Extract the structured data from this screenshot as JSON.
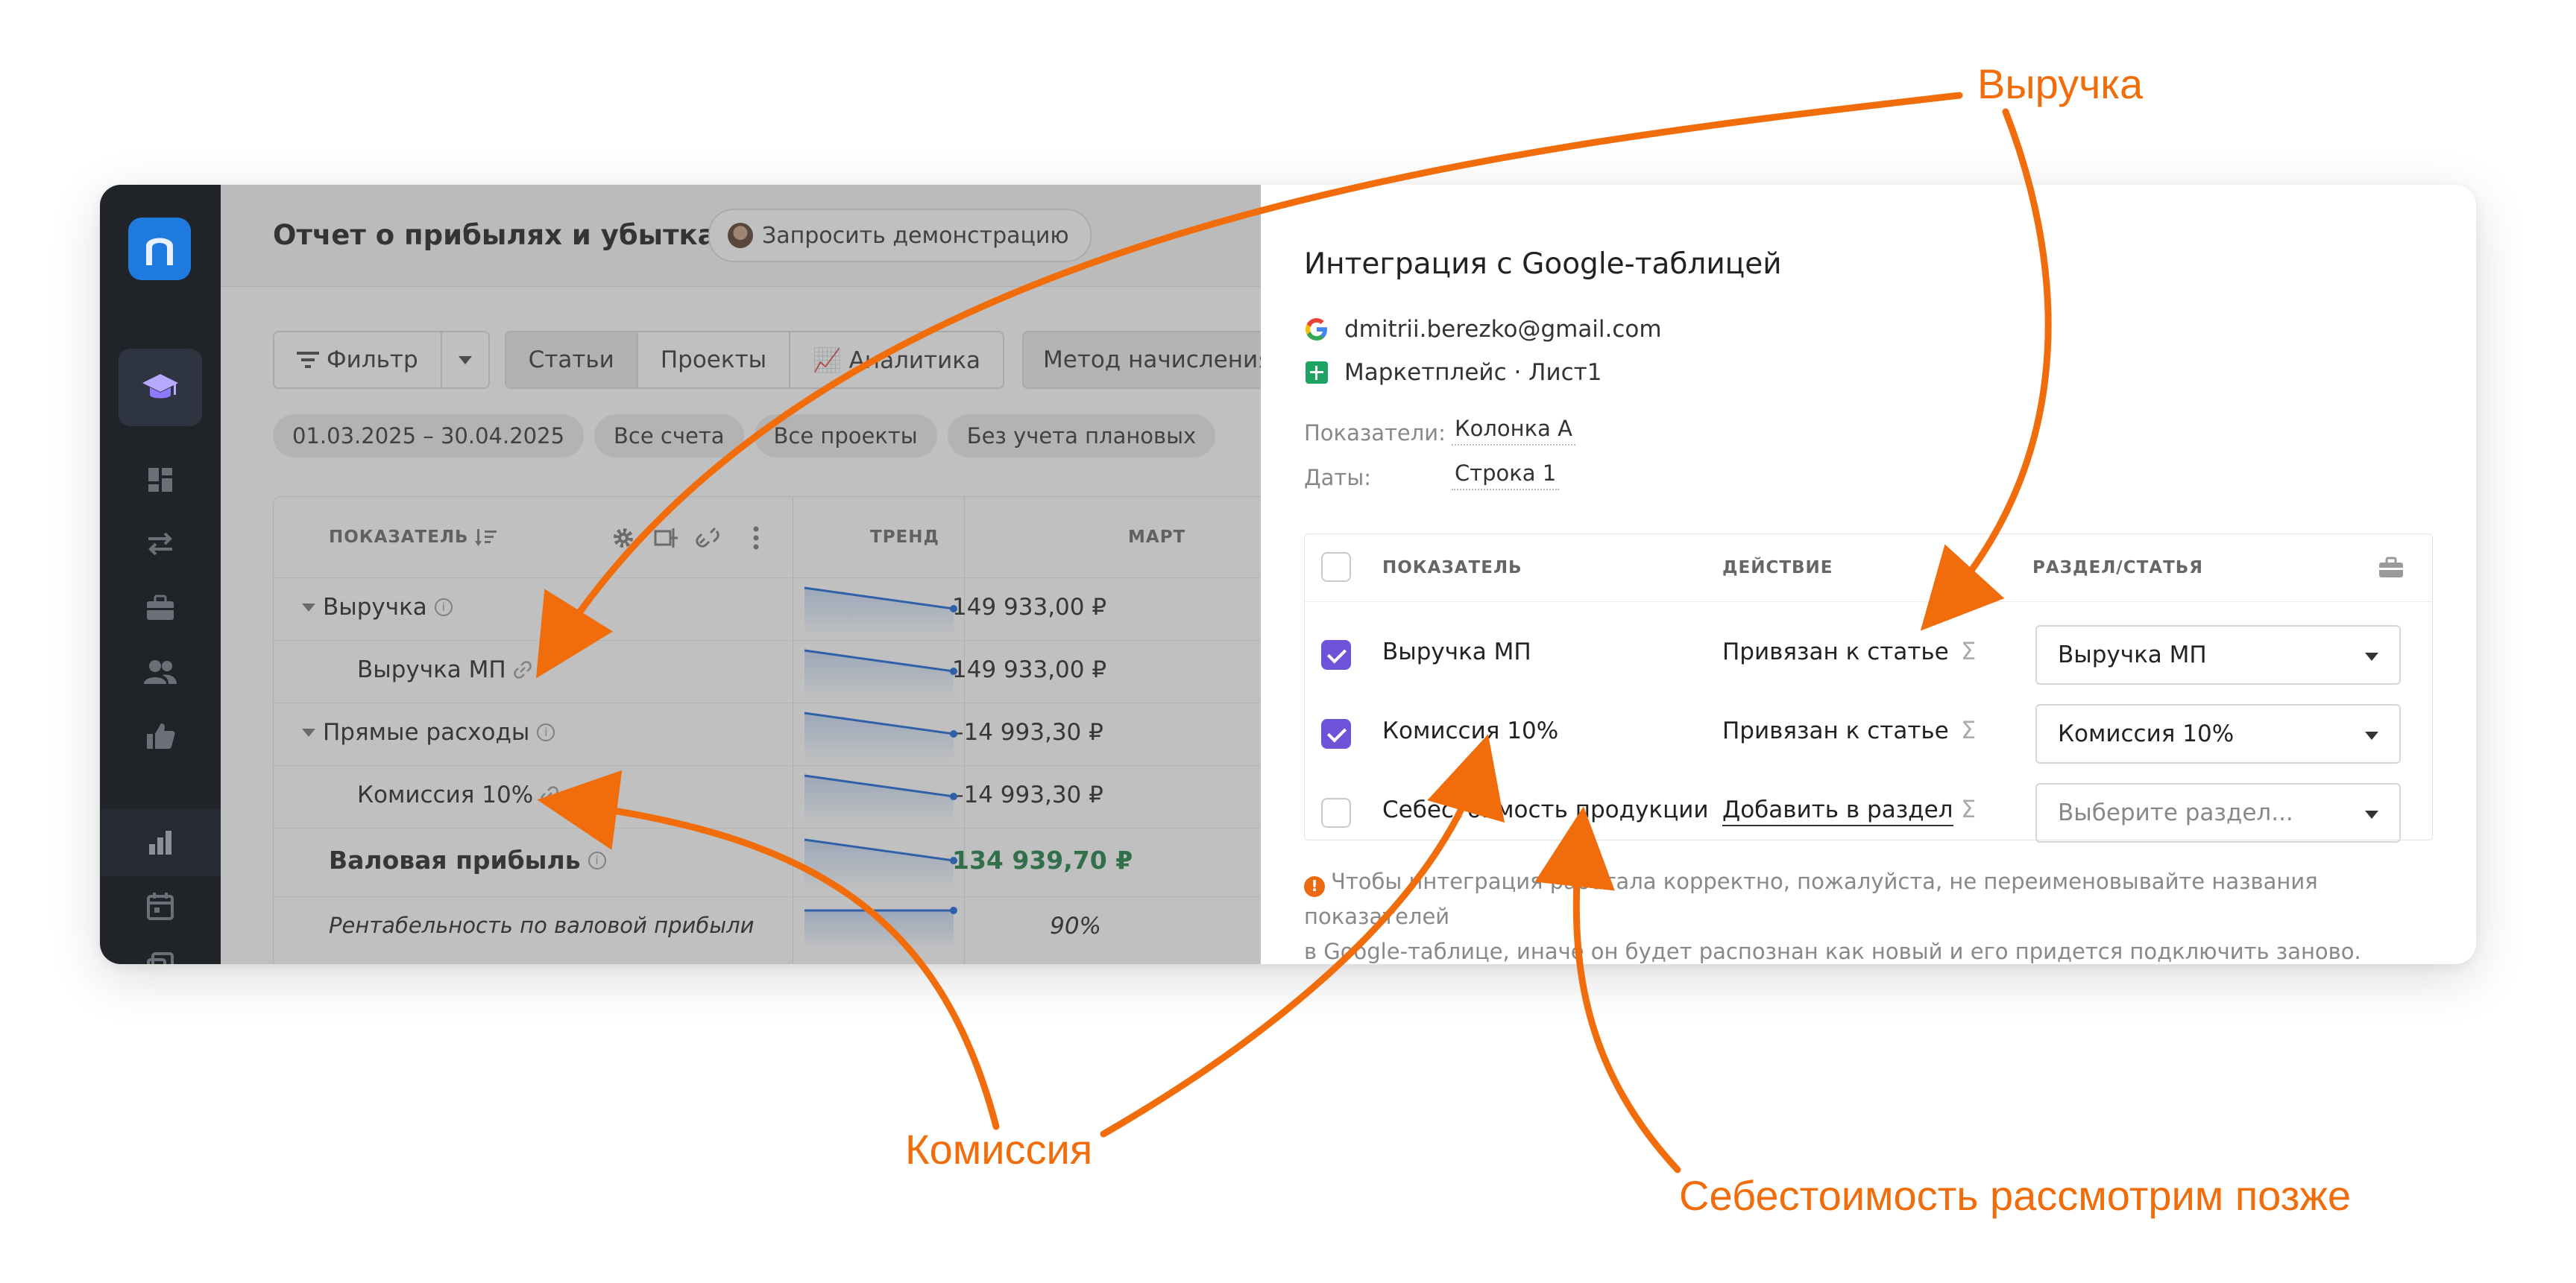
{
  "annotations": {
    "revenue": "Выручка",
    "commission": "Комиссия",
    "cost": "Себестоимость рассмотрим позже"
  },
  "sidebar": {
    "icons": [
      "app-logo",
      "academy-icon",
      "dashboard-icon",
      "transfers-icon",
      "briefcase-icon",
      "users-icon",
      "thumbs-up-icon",
      "reports-chart-icon",
      "calendar-icon",
      "documents-icon"
    ],
    "accent": "#1f7ae0"
  },
  "main": {
    "title": "Отчет о прибылях и убытках",
    "demo_button": "Запросить демонстрацию",
    "filter_button": "Фильтр",
    "tabs": [
      {
        "label": "Статьи",
        "active": true
      },
      {
        "label": "Проекты",
        "active": false
      },
      {
        "label": "📈 Аналитика",
        "active": false
      }
    ],
    "method_button": "Метод начисления",
    "chips": [
      "01.03.2025 – 30.04.2025",
      "Все счета",
      "Все проекты",
      "Без учета плановых"
    ],
    "table": {
      "col_indicator": "ПОКАЗАТЕЛЬ",
      "col_trend": "ТРЕНД",
      "col_march": "МАРТ",
      "rows": [
        {
          "label": "Выручка",
          "value": "149 933,00 ₽"
        },
        {
          "label": "Выручка МП",
          "value": "149 933,00 ₽"
        },
        {
          "label": "Прямые расходы",
          "value": "–14 993,30 ₽"
        },
        {
          "label": "Комиссия 10%",
          "value": "–14 993,30 ₽"
        },
        {
          "label": "Валовая прибыль",
          "value": "134 939,70 ₽"
        },
        {
          "label": "Рентабельность по валовой прибыли",
          "value": "90%"
        }
      ],
      "positive_color": "#1a7f45"
    }
  },
  "panel": {
    "title": "Интеграция с Google-таблицей",
    "account": "dmitrii.berezko@gmail.com",
    "sheet": "Маркетплейс · Лист1",
    "indicators_label": "Показатели:",
    "indicators_value": "Колонка А",
    "dates_label": "Даты:",
    "dates_value": "Строка 1",
    "table": {
      "col_indicator": "ПОКАЗАТЕЛЬ",
      "col_action": "ДЕЙСТВИЕ",
      "col_section": "РАЗДЕЛ/СТАТЬЯ",
      "rows": [
        {
          "name": "Выручка МП",
          "checked": true,
          "action": "Привязан к статье",
          "section": "Выручка МП"
        },
        {
          "name": "Комиссия 10%",
          "checked": true,
          "action": "Привязан к статье",
          "section": "Комиссия 10%"
        },
        {
          "name": "Себестоимость продукции",
          "checked": false,
          "action": "Добавить в раздел",
          "section_placeholder": "Выберите раздел..."
        }
      ],
      "sigma": "Σ"
    },
    "warning_line1": "Чтобы интеграция работала корректно, пожалуйста, не переименовывайте названия показателей",
    "warning_line2": "в Google-таблице, иначе он будет распознан как новый и его придется подключить заново.",
    "accent_checkbox": "#6e52d8",
    "annotation_color": "#f16d0c"
  }
}
